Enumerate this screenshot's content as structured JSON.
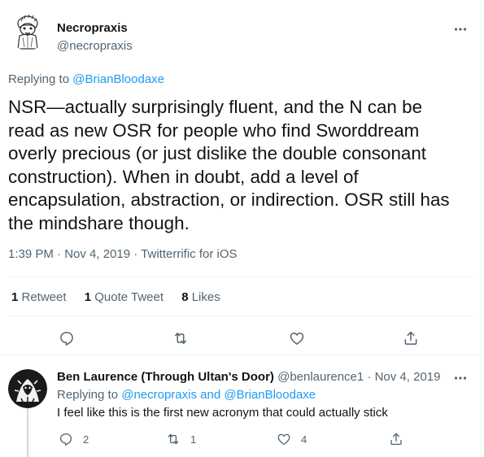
{
  "main_tweet": {
    "author_name": "Necropraxis",
    "author_handle": "@necropraxis",
    "replying_prefix": "Replying to ",
    "replying_to": "@BrianBloodaxe",
    "text": "NSR—actually surprisingly fluent, and the N can be read as new OSR for people who find Sworddream overly precious (or just dislike the double consonant construction). When in doubt, add a level of encapsulation, abstraction, or indirection. OSR still has the mindshare though.",
    "time": "1:39 PM",
    "date": "Nov 4, 2019",
    "client": "Twitterrific for iOS",
    "separator": " · ",
    "stats": {
      "retweets_count": "1",
      "retweets_label": " Retweet",
      "quotes_count": "1",
      "quotes_label": " Quote Tweet",
      "likes_count": "8",
      "likes_label": " Likes"
    },
    "icons": {
      "reply": "reply-icon",
      "retweet": "retweet-icon",
      "like": "heart-icon",
      "share": "share-icon",
      "more": "more-icon"
    }
  },
  "reply_tweet": {
    "author_name": "Ben Laurence (Through Ultan's Door)",
    "author_handle": "@benlaurence1",
    "separator": " · ",
    "date": "Nov 4, 2019",
    "replying_prefix": "Replying to ",
    "replying_to": "@necropraxis and @BrianBloodaxe",
    "text": "I feel like this is the first new acronym that could actually stick",
    "reply_count": "2",
    "retweet_count": "1",
    "like_count": "4"
  },
  "colors": {
    "link": "#1d9bf0",
    "secondary_text": "#536471",
    "primary_text": "#0f1419",
    "divider": "#eff3f4"
  }
}
